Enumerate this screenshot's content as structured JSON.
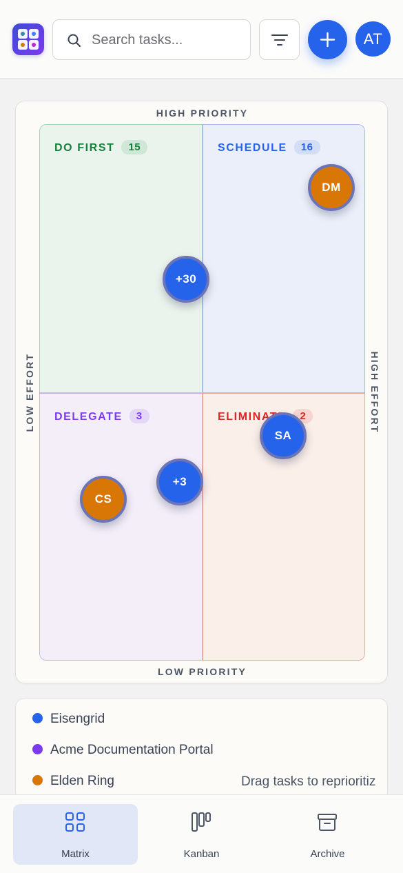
{
  "header": {
    "logo_icon": "eisenhower-grid-logo",
    "search": {
      "placeholder": "Search tasks...",
      "value": ""
    },
    "filter_icon": "filter-lines-icon",
    "add_icon": "plus-icon",
    "user_initials": "AT",
    "accent": "#2563eb"
  },
  "matrix": {
    "axis": {
      "top": "HIGH PRIORITY",
      "bottom": "LOW PRIORITY",
      "left": "LOW EFFORT",
      "right": "HIGH EFFORT"
    },
    "quadrants": {
      "do_first": {
        "title": "DO FIRST",
        "count": "15",
        "color": "#15803d"
      },
      "schedule": {
        "title": "SCHEDULE",
        "count": "16",
        "color": "#2563eb"
      },
      "delegate": {
        "title": "DELEGATE",
        "count": "3",
        "color": "#7e3af2"
      },
      "eliminate": {
        "title": "ELIMINATE",
        "count": "2",
        "color": "#dc2626"
      }
    },
    "tasks": [
      {
        "label": "DM",
        "color": "orange"
      },
      {
        "label": "+30",
        "color": "blue"
      },
      {
        "label": "SA",
        "color": "blue"
      },
      {
        "label": "+3",
        "color": "blue"
      },
      {
        "label": "CS",
        "color": "orange"
      }
    ]
  },
  "legend": {
    "projects": [
      {
        "name": "Eisengrid",
        "color": "#2563eb"
      },
      {
        "name": "Acme Documentation Portal",
        "color": "#7c3aed"
      },
      {
        "name": "Elden Ring",
        "color": "#d97706"
      }
    ],
    "hint": "Drag tasks to reprioritiz"
  },
  "nav": {
    "items": [
      {
        "label": "Matrix",
        "icon": "grid-icon",
        "active": true
      },
      {
        "label": "Kanban",
        "icon": "kanban-icon",
        "active": false
      },
      {
        "label": "Archive",
        "icon": "archive-box-icon",
        "active": false
      }
    ]
  }
}
